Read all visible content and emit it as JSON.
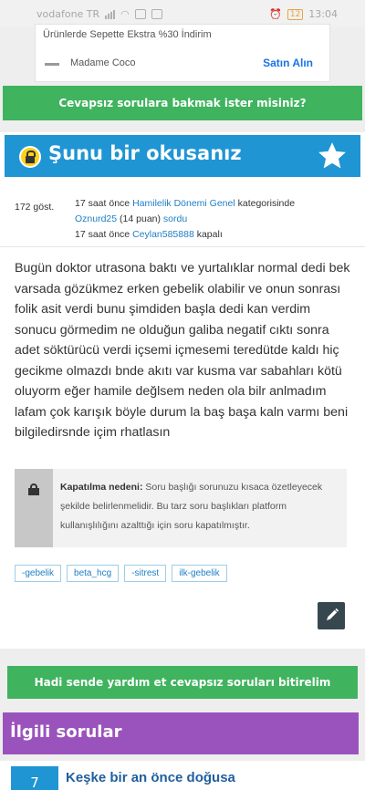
{
  "status_bar": {
    "carrier": "vodafone TR",
    "battery": "12",
    "time": "13:04"
  },
  "ad": {
    "title": "Ürünlerde Sepette Ekstra %30 İndirim",
    "brand": "Madame Coco",
    "cta": "Satın Alın"
  },
  "top_button": "Cevapsız sorulara bakmak ister misiniz?",
  "question": {
    "title": "Şunu bir okusanız",
    "views": "172 göst.",
    "meta": {
      "line1_prefix": "17 saat önce",
      "category": "Hamilelik Dönemi Genel",
      "line1_suffix": "kategorisinde",
      "user": "Oznurd25",
      "points": "(14 puan)",
      "action": "sordu",
      "line3_prefix": "17 saat önce",
      "closer": "Ceylan585888",
      "line3_suffix": "kapalı"
    },
    "body": "Bugün doktor utrasona baktı ve yurtalıklar normal dedi bek varsada gözükmez erken gebelik olabilir ve onun sonrası folik asit verdi bunu şimdiden başla dedi kan verdim sonucu görmedim ne olduğun galiba negatif cıktı sonra adet söktürücü verdi içsemi içmesemi teredütde kaldı hiç gecikme olmazdı bnde akıtı var kusma var sabahları kötü oluyorm eğer hamile değlsem neden ola bilr anlmadım lafam çok karışık böyle durum la baş başa kaln varmı beni bilgiledirsnde içim rhatlasın",
    "close_label": "Kapatılma nedeni:",
    "close_reason": "Soru başlığı sorunuzu kısaca özetleyecek şekilde belirlenmelidir. Bu tarz soru başlıkları platform kullanışlılığını azalttığı için soru kapatılmıştır.",
    "tags": [
      "-gebelik",
      "beta_hcg",
      "-sitrest",
      "ilk-gebelik"
    ]
  },
  "bottom_button": "Hadi sende yardım et cevapsız soruları bitirelim",
  "related": {
    "heading": "İlgili sorular",
    "items": [
      {
        "count": "7",
        "title": "Keşke bir an önce doğusa"
      }
    ]
  },
  "colors": {
    "blue": "#1f95d3",
    "green": "#3fb35e",
    "purple": "#9a53bd",
    "lock_yellow": "#ffd11a"
  }
}
